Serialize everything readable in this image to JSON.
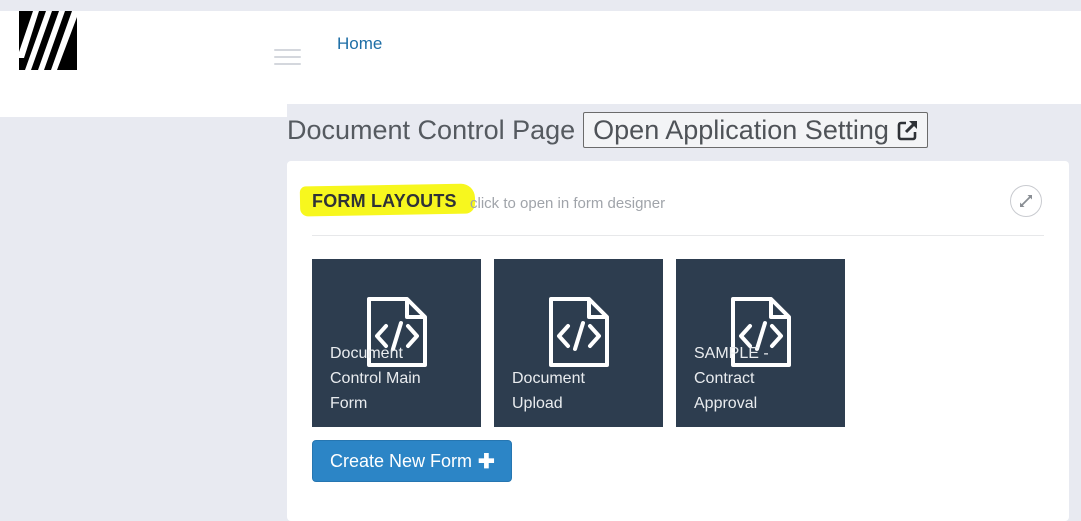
{
  "nav": {
    "home_label": "Home"
  },
  "page": {
    "title": "Document Control Page",
    "app_setting_label": "Open Application Setting"
  },
  "panel": {
    "title": "FORM LAYOUTS",
    "subtitle": "click to open in form designer",
    "forms": [
      {
        "label": "Document Control Main Form",
        "icon": "file-code-icon"
      },
      {
        "label": "Document Upload",
        "icon": "file-code-icon"
      },
      {
        "label": "SAMPLE - Contract Approval",
        "icon": "file-code-icon"
      }
    ],
    "create_label": "Create New Form",
    "create_icon": "plus-icon"
  },
  "colors": {
    "tile_bg": "#2d3d4f",
    "primary_button": "#2c85c6",
    "highlight": "#f7f71e",
    "link": "#1e6ea6"
  }
}
